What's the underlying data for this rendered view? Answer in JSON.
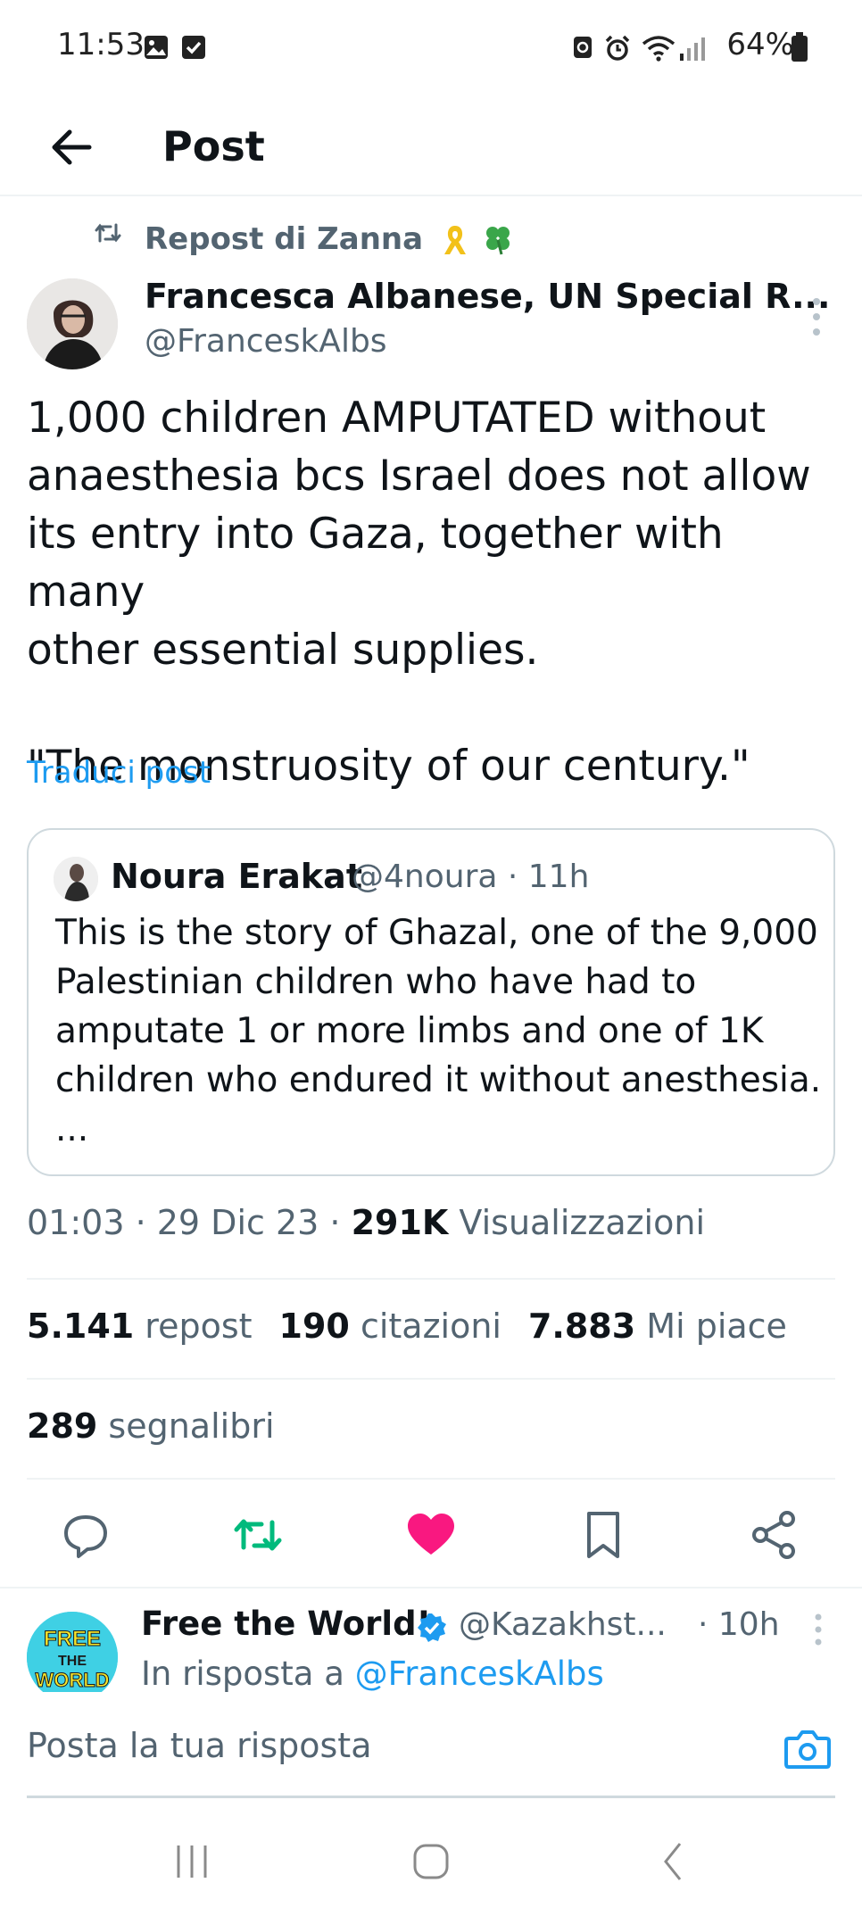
{
  "status_bar": {
    "time": "11:53",
    "battery": "64%"
  },
  "header": {
    "title": "Post"
  },
  "repost": {
    "label": "Repost di Zanna"
  },
  "author": {
    "name": "Francesca Albanese, UN Special R...",
    "handle": "@FranceskAlbs"
  },
  "post": {
    "text_lines": [
      "1,000 children AMPUTATED without",
      "anaesthesia bcs Israel does not allow",
      "its entry into Gaza, together with many",
      "other essential supplies."
    ],
    "quote_line": "\"The monstruosity of our century.\"",
    "translate_label": "Traduci post"
  },
  "quoted_post": {
    "name": "Noura Erakat",
    "handle_time": "@4noura · 11h",
    "text_lines": [
      "This is the story of Ghazal, one of the  9,000",
      "Palestinian children who have had to",
      "amputate 1 or more limbs and one of 1K",
      "children who endured it without anesthesia.",
      "..."
    ]
  },
  "meta": {
    "time_date": "01:03 · 29 Dic 23 · ",
    "views_count": "291K",
    "views_label": " Visualizzazioni"
  },
  "stats": {
    "reposts_count": "5.141",
    "reposts_label": "repost",
    "quotes_count": "190",
    "quotes_label": "citazioni",
    "likes_count": "7.883",
    "likes_label": "Mi piace",
    "bookmarks_count": "289",
    "bookmarks_label": "segnalibri"
  },
  "actions": {
    "reply_icon": "reply-icon",
    "repost_icon": "repost-icon",
    "like_icon": "heart-icon",
    "bookmark_icon": "bookmark-icon",
    "share_icon": "share-icon",
    "repost_color": "#00ba7c",
    "like_color": "#f91880"
  },
  "reply_preview": {
    "name": "Free the World!",
    "handle": "@Kazakhst...",
    "time": "· 10h",
    "reply_prefix": "In risposta a ",
    "reply_mention": "@FranceskAlbs",
    "avatar_text_top": "FREE",
    "avatar_text_mid": "THE",
    "avatar_text_bottom": "WORLD"
  },
  "compose": {
    "placeholder": "Posta la tua risposta"
  },
  "colors": {
    "accent": "#1d9bf0",
    "text_primary": "#0f1419",
    "text_secondary": "#536471"
  }
}
